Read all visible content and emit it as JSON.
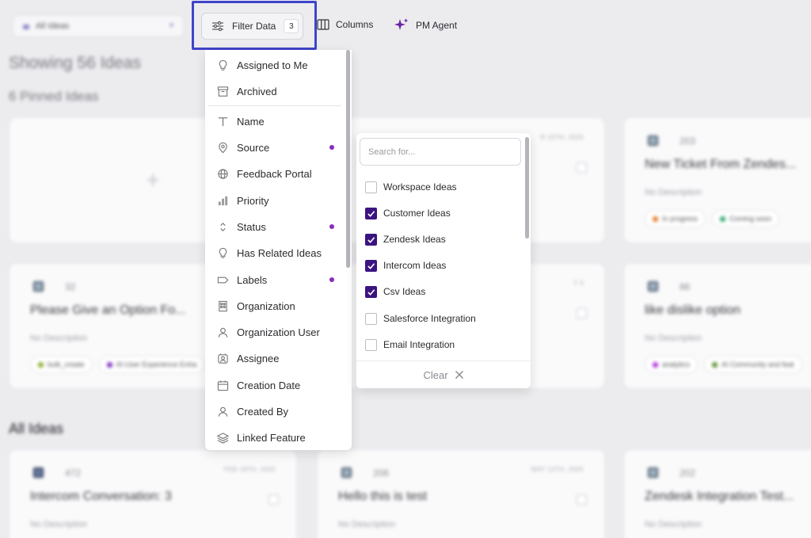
{
  "toolbar": {
    "view_select": "All Ideas",
    "filter_label": "Filter Data",
    "filter_count": "3",
    "columns_label": "Columns",
    "pm_agent_label": "PM Agent",
    "accent": "#3f44c9"
  },
  "page": {
    "showing": "Showing 56 Ideas",
    "pinned_heading": "6 Pinned Ideas",
    "all_heading": "All Ideas"
  },
  "cards": {
    "c1": {
      "title": "Please Give an Option Fo...",
      "number": "32",
      "desc": "No Description",
      "tag1": "bulk_create",
      "tag2": "AI-User Experience Enha"
    },
    "c2": {
      "title": "New Ticket From Zendes...",
      "number": "203",
      "desc": "No Description",
      "tag1": "In progress",
      "tag2": "Coming soon"
    },
    "c3": {
      "title": "like dislike option",
      "number": "86",
      "desc": "No Description",
      "tag1": "analytics",
      "tag2": "AI Community and feat"
    },
    "c4": {
      "title": "Intercom Conversation: 3",
      "number": "472",
      "date": "FEB 18TH, 2025",
      "desc": "No Description"
    },
    "c5": {
      "title": "Hello this is test",
      "number": "206",
      "date": "MAY 13TH, 2025",
      "desc": "No Description"
    },
    "c6": {
      "title": "Zendesk Integration Test...",
      "number": "202",
      "desc": "No Description"
    },
    "mid_date1": "R 15TH, 2025",
    "mid_date2": "Y 3"
  },
  "filter_menu": {
    "items": [
      {
        "label": "Assigned to Me",
        "icon": "bulb-icon"
      },
      {
        "label": "Archived",
        "icon": "archive-icon"
      },
      {
        "label": "Name",
        "icon": "text-icon"
      },
      {
        "label": "Source",
        "icon": "pin-icon",
        "active": true
      },
      {
        "label": "Feedback Portal",
        "icon": "globe-icon"
      },
      {
        "label": "Priority",
        "icon": "bars-icon"
      },
      {
        "label": "Status",
        "icon": "updown-icon",
        "active": true
      },
      {
        "label": "Has Related Ideas",
        "icon": "bulb-icon"
      },
      {
        "label": "Labels",
        "icon": "label-icon",
        "active": true
      },
      {
        "label": "Organization",
        "icon": "building-icon"
      },
      {
        "label": "Organization User",
        "icon": "user-icon"
      },
      {
        "label": "Assignee",
        "icon": "assignee-icon"
      },
      {
        "label": "Creation Date",
        "icon": "calendar-icon"
      },
      {
        "label": "Created By",
        "icon": "user-icon"
      },
      {
        "label": "Linked Feature",
        "icon": "layers-icon"
      }
    ]
  },
  "source_panel": {
    "search_placeholder": "Search for...",
    "options": [
      {
        "label": "Workspace Ideas",
        "checked": false
      },
      {
        "label": "Customer Ideas",
        "checked": true
      },
      {
        "label": "Zendesk Ideas",
        "checked": true
      },
      {
        "label": "Intercom Ideas",
        "checked": true
      },
      {
        "label": "Csv Ideas",
        "checked": true
      },
      {
        "label": "Salesforce Integration",
        "checked": false
      },
      {
        "label": "Email Integration",
        "checked": false
      }
    ],
    "clear_label": "Clear",
    "check_color": "#3b1480"
  }
}
